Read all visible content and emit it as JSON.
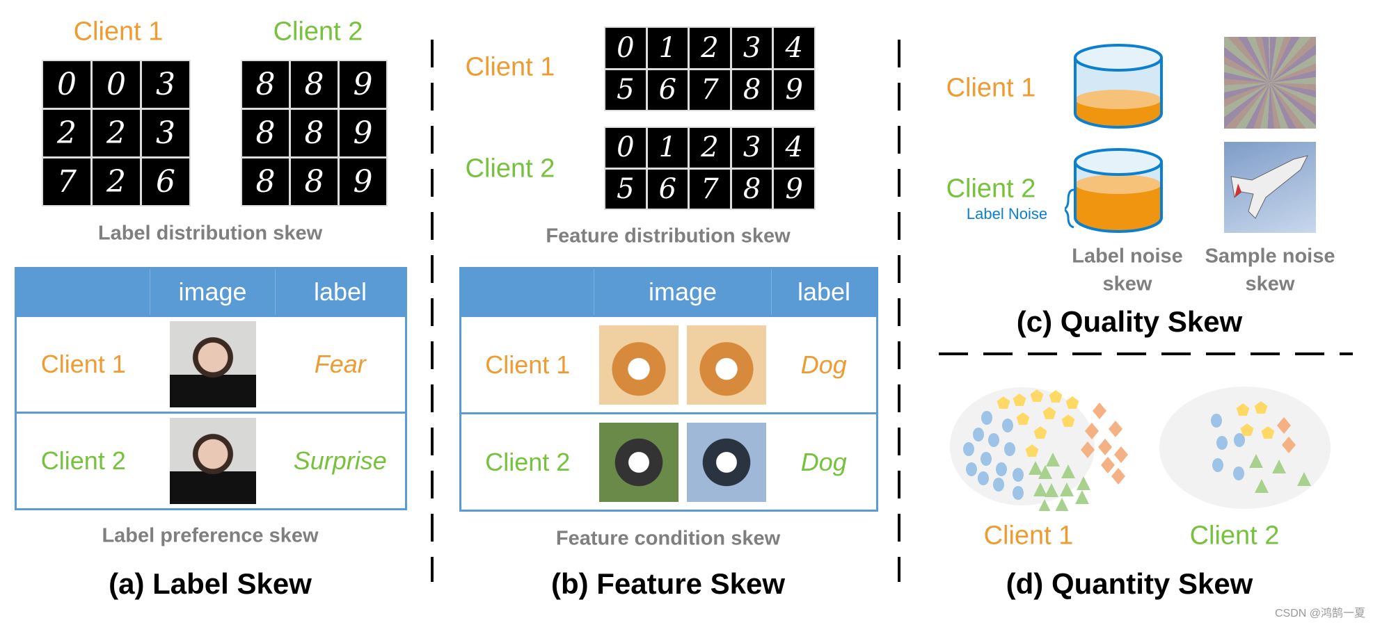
{
  "colors": {
    "client1": "#EE9C32",
    "client2": "#76C23C",
    "table_header": "#5B9BD5",
    "caption": "#7f7f7f",
    "label_noise": "#0B7FD0"
  },
  "label_skew": {
    "client1": "Client 1",
    "client2": "Client 2",
    "digits_client1": [
      [
        "0",
        "0",
        "3"
      ],
      [
        "2",
        "2",
        "3"
      ],
      [
        "7",
        "2",
        "6"
      ]
    ],
    "digits_client2": [
      [
        "8",
        "8",
        "9"
      ],
      [
        "8",
        "8",
        "9"
      ],
      [
        "8",
        "8",
        "9"
      ]
    ],
    "dist_caption": "Label distribution skew",
    "table": {
      "headers": [
        "",
        "image",
        "label"
      ],
      "rows": [
        {
          "client": "Client 1",
          "label": "Fear"
        },
        {
          "client": "Client 2",
          "label": "Surprise"
        }
      ]
    },
    "pref_caption": "Label preference skew",
    "title": "(a) Label Skew"
  },
  "feature_skew": {
    "client1": "Client 1",
    "client2": "Client 2",
    "digits_client1": [
      [
        "0",
        "1",
        "2",
        "3",
        "4"
      ],
      [
        "5",
        "6",
        "7",
        "8",
        "9"
      ]
    ],
    "digits_client2": [
      [
        "0",
        "1",
        "2",
        "3",
        "4"
      ],
      [
        "5",
        "6",
        "7",
        "8",
        "9"
      ]
    ],
    "dist_caption": "Feature distribution skew",
    "table": {
      "headers": [
        "",
        "image",
        "label"
      ],
      "rows": [
        {
          "client": "Client 1",
          "label": "Dog"
        },
        {
          "client": "Client 2",
          "label": "Dog"
        }
      ]
    },
    "cond_caption": "Feature condition skew",
    "title": "(b) Feature Skew"
  },
  "quality_skew": {
    "client1": "Client 1",
    "client2": "Client 2",
    "label_noise": "Label Noise",
    "fill_client1": 0.25,
    "fill_client2": 0.6,
    "caption_label": [
      "Label noise",
      "skew"
    ],
    "caption_sample": [
      "Sample noise",
      "skew"
    ],
    "title": "(c) Quality Skew"
  },
  "quantity_skew": {
    "client1": "Client 1",
    "client2": "Client 2",
    "title": "(d) Quantity Skew",
    "shape_colors": {
      "circle": "#9DC3E6",
      "pentagon": "#FFD966",
      "diamond": "#F4B183",
      "triangle": "#A9D18E"
    }
  },
  "watermark": "CSDN @鸿鹄一夏"
}
